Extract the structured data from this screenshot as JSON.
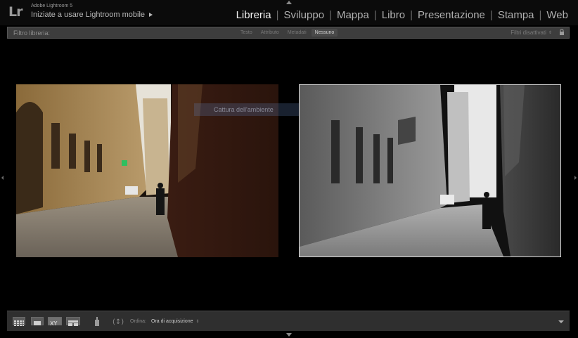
{
  "identity": {
    "logo": "Lr",
    "app_name": "Adobe Lightroom 5",
    "user_title": "Iniziate a usare Lightroom mobile"
  },
  "modules": [
    {
      "label": "Libreria",
      "active": true
    },
    {
      "label": "Sviluppo",
      "active": false
    },
    {
      "label": "Mappa",
      "active": false
    },
    {
      "label": "Libro",
      "active": false
    },
    {
      "label": "Presentazione",
      "active": false
    },
    {
      "label": "Stampa",
      "active": false
    },
    {
      "label": "Web",
      "active": false
    }
  ],
  "filter_bar": {
    "label": "Filtro libreria:",
    "tabs": [
      "Testo",
      "Attributo",
      "Metadati",
      "Nessuno"
    ],
    "active_tab": "Nessuno",
    "status": "Filtri disattivati"
  },
  "compare": {
    "tooltip": "Cattura dell'ambiente"
  },
  "toolbar": {
    "sort_label": "Ordina:",
    "sort_value": "Ora di acquisizione"
  },
  "colors": {
    "accent_active": "#f2f2f2",
    "panel": "#3d3d3d",
    "background": "#000000"
  }
}
